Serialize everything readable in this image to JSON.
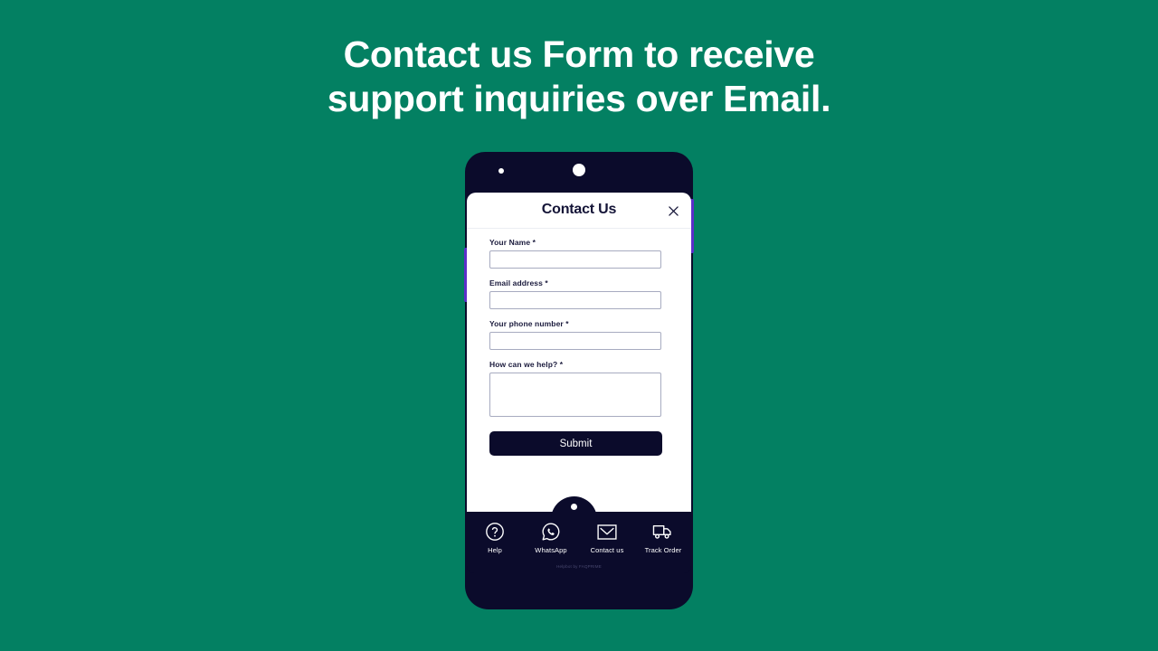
{
  "colors": {
    "background": "#038062",
    "phone_body": "#0b0b2b",
    "card": "#ffffff",
    "accent_purple": "#5b2fc9",
    "input_border": "#a7abc0",
    "text_dark": "#141437"
  },
  "headline": {
    "line1": "Contact us Form to receive",
    "line2": "support inquiries over Email."
  },
  "phone": {
    "camera_icon": "camera-dot",
    "sensor_icon": "sensor-dot",
    "side_button_icon": "side-button"
  },
  "card": {
    "title": "Contact Us",
    "close_icon": "close-icon",
    "close_glyph": "✕"
  },
  "form": {
    "fields": [
      {
        "label": "Your Name *",
        "value": "",
        "placeholder": "",
        "type": "text",
        "name": "your-name"
      },
      {
        "label": "Email address *",
        "value": "",
        "placeholder": "",
        "type": "text",
        "name": "email-address"
      },
      {
        "label": "Your phone number *",
        "value": "",
        "placeholder": "",
        "type": "text",
        "name": "phone-number"
      },
      {
        "label": "How can we help? *",
        "value": "",
        "placeholder": "",
        "type": "textarea",
        "name": "how-can-we-help"
      }
    ],
    "submit_label": "Submit"
  },
  "navbar": {
    "items": [
      {
        "label": "Help",
        "icon": "question-circle-icon"
      },
      {
        "label": "WhatsApp",
        "icon": "whatsapp-icon"
      },
      {
        "label": "Contact us",
        "icon": "envelope-icon"
      },
      {
        "label": "Track Order",
        "icon": "truck-icon"
      }
    ],
    "credit": "Helpbot by FAQPRIME",
    "notch_dot_icon": "notch-indicator-dot"
  }
}
